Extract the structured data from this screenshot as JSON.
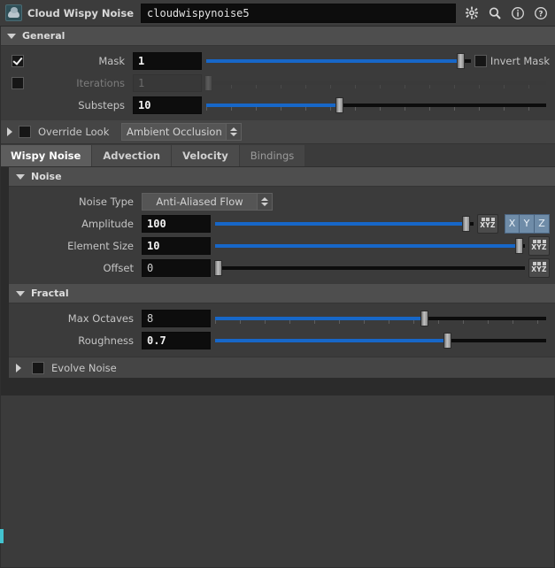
{
  "titlebar": {
    "node_icon": "cloud-noise-icon",
    "node_type": "Cloud Wispy Noise",
    "node_name": "cloudwispynoise5",
    "icons": [
      {
        "name": "gear-icon",
        "glyph": "⚙"
      },
      {
        "name": "search-icon",
        "glyph": "○"
      },
      {
        "name": "info-icon",
        "glyph": "i"
      },
      {
        "name": "help-icon",
        "glyph": "?"
      }
    ]
  },
  "general": {
    "header": "General",
    "rows": [
      {
        "label": "Mask",
        "value": "1",
        "checkbox": true,
        "enabled": true,
        "slider_pct": 96,
        "ticks": false,
        "trailing_checkbox": false,
        "trailing_label": "Invert Mask"
      },
      {
        "label": "Iterations",
        "value": "1",
        "checkbox": false,
        "enabled": false,
        "slider_pct": 1,
        "ticks": true,
        "trailing_label": ""
      },
      {
        "label": "Substeps",
        "value": "10",
        "checkbox": null,
        "enabled": true,
        "slider_pct": 39,
        "ticks": true,
        "trailing_label": ""
      }
    ]
  },
  "override_look": {
    "label": "Override Look",
    "checked": false,
    "value": "Ambient Occlusion",
    "expanded": false
  },
  "tabs": [
    {
      "label": "Wispy Noise",
      "state": "active"
    },
    {
      "label": "Advection",
      "state": "normal"
    },
    {
      "label": "Velocity",
      "state": "normal"
    },
    {
      "label": "Bindings",
      "state": "muted"
    }
  ],
  "noise": {
    "header": "Noise",
    "noise_type": {
      "label": "Noise Type",
      "value": "Anti-Aliased Flow"
    },
    "rows": [
      {
        "label": "Amplitude",
        "value": "100",
        "bold": true,
        "slider_pct": 97,
        "ticks": false,
        "xyz_button": true,
        "axis_buttons": [
          "X",
          "Y",
          "Z"
        ]
      },
      {
        "label": "Element Size",
        "value": "10",
        "bold": true,
        "slider_pct": 98,
        "ticks": false,
        "xyz_button": true,
        "axis_buttons": []
      },
      {
        "label": "Offset",
        "value": "0",
        "bold": false,
        "slider_pct": 1,
        "ticks": false,
        "xyz_button": true,
        "axis_buttons": []
      }
    ]
  },
  "fractal": {
    "header": "Fractal",
    "rows": [
      {
        "label": "Max Octaves",
        "value": "8",
        "bold": false,
        "slider_pct": 63,
        "ticks": true
      },
      {
        "label": "Roughness",
        "value": "0.7",
        "bold": true,
        "slider_pct": 70,
        "ticks": false
      }
    ]
  },
  "evolve_noise": {
    "label": "Evolve Noise",
    "checked": false,
    "expanded": false
  },
  "colors": {
    "accent_blue": "#1767c8",
    "axis_button": "#6f8ca8",
    "panel_bg": "#3b3b3b",
    "section_header": "#4e4e4e",
    "scroll_marker": "#43c3cf"
  }
}
